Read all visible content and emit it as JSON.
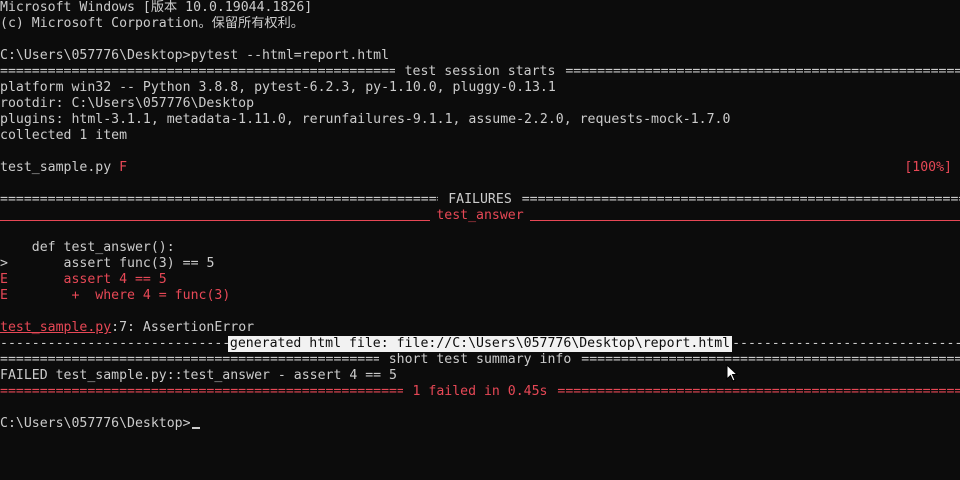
{
  "header": {
    "line1": "Microsoft Windows [版本 10.0.19044.1826]",
    "line2": "(c) Microsoft Corporation。保留所有权利。"
  },
  "command": {
    "prompt": "C:\\Users\\057776\\Desktop>",
    "text": "pytest --html=report.html"
  },
  "session": {
    "title": " test session starts ",
    "platform": "platform win32 -- Python 3.8.8, pytest-6.2.3, py-1.10.0, pluggy-0.13.1",
    "rootdir": "rootdir: C:\\Users\\057776\\Desktop",
    "plugins": "plugins: html-3.1.1, metadata-1.11.0, rerunfailures-9.1.1, assume-2.2.0, requests-mock-1.7.0",
    "collected": "collected 1 item"
  },
  "result": {
    "file": "test_sample.py ",
    "status": "F",
    "percent": "[100%]"
  },
  "failures": {
    "title": " FAILURES ",
    "test_name": "test_answer",
    "code_def": "    def test_answer():",
    "arrow_marker": ">",
    "assert_line": "       assert func(3) == 5",
    "err1_marker": "E",
    "err1": "       assert 4 == 5",
    "err2_marker": "E",
    "err2": "        +  where 4 = func(3)",
    "location_file": "test_sample.py",
    "location_rest": ":7: AssertionError"
  },
  "generated": {
    "text": "generated html file: file://C:\\Users\\057776\\Desktop\\report.html"
  },
  "summary": {
    "title": " short test summary info ",
    "failed_line": "FAILED test_sample.py::test_answer - assert 4 == 5",
    "final": " 1 failed in 0.45s "
  },
  "final_prompt": "C:\\Users\\057776\\Desktop>",
  "colors": {
    "background": "#0c0c0c",
    "foreground": "#cccccc",
    "error": "#e74856"
  },
  "icons": {
    "cursor": "text-cursor-icon",
    "pointer": "mouse-pointer-icon"
  }
}
